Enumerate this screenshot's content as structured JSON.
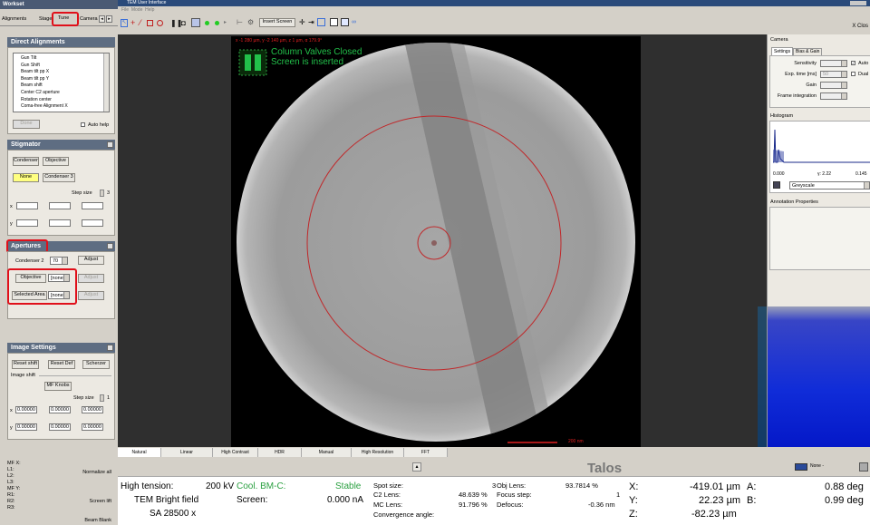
{
  "workset": {
    "title": "Workset",
    "tabs": [
      "Alignments",
      "Stage",
      "Tune",
      "Camera"
    ],
    "direct_alignments": {
      "title": "Direct Alignments",
      "items": [
        "Gun Tilt",
        "Gun Shift",
        "Beam tilt pp X",
        "Beam tilt pp Y",
        "Beam shift",
        "Center C2 aperture",
        "Rotation center",
        "Coma-free Alignment X"
      ],
      "done_label": "Done",
      "auto_help_label": "Auto help"
    },
    "stigmator": {
      "title": "Stigmator",
      "condenser_label": "Condenser",
      "objective_label": "Objective",
      "none_label": "None",
      "condenser3_label": "Condenser 3",
      "step_size_label": "Step size",
      "step_value": "3",
      "x_label": "x",
      "y_label": "y"
    },
    "apertures": {
      "title": "Apertures",
      "condenser2_label": "Condenser 2",
      "condenser2_value": "70",
      "adjust_label": "Adjust",
      "objective_label": "Objective",
      "objective_value": "[none]",
      "selected_area_label": "Selected Area",
      "selected_area_value": "[none]"
    },
    "image_settings": {
      "title": "Image Settings",
      "reset_shift_label": "Reset shift",
      "reset_def_label": "Reset Def",
      "scherzer_label": "Scherzer",
      "image_shift_label": "Image shift",
      "mf_knobs_label": "MF Knobs",
      "step_size_label": "Step size",
      "step_value": "1",
      "x_label": "x",
      "y_label": "y",
      "values": [
        "0.00000",
        "0.00000",
        "0.00000",
        "0.00000",
        "0.00000",
        "0.00000"
      ]
    },
    "mf_labels": [
      "MF X:",
      "L1:",
      "L2:",
      "L3:",
      "MF Y:",
      "R1:",
      "R2:",
      "R3:"
    ],
    "normalize_all": "Normalize all",
    "screen_lift": "Screen lift",
    "beam_blank": "Beam Blank"
  },
  "app": {
    "title": "TEM User Interface",
    "menu": [
      "File",
      "Mode",
      "Help"
    ],
    "insert_screen_label": "Insert Screen",
    "close_label": "X Clos"
  },
  "viewer": {
    "overlay_coords": "x -1 280 µm, y -2 140 µm, z 1 µm, α 179.9°",
    "status_line1": "Column Valves Closed",
    "status_line2": "Screen is inserted",
    "scale_bar": "200 nm",
    "tabs": [
      "Natural",
      "Linear",
      "High Contrast",
      "HDR",
      "Manual",
      "High Resolution",
      "FFT"
    ]
  },
  "camera": {
    "title": "Camera",
    "tabs": [
      "Settings",
      "Bias & Gain"
    ],
    "sensitivity_label": "Sensitivity",
    "auto_label": "Auto",
    "exp_time_label": "Exp. time [ms]",
    "exp_value": "50",
    "dual_label": "Dual",
    "gain_label": "Gain",
    "frame_integration_label": "Frame integration",
    "histogram_title": "Histogram",
    "hist_min": "0.000",
    "hist_gamma": "γ: 2.22",
    "hist_max": "0.145",
    "colormap": "Greyscale",
    "annotation_title": "Annotation Properties"
  },
  "status": {
    "talos": "Talos",
    "none_label": "None -",
    "high_tension_label": "High tension:",
    "high_tension_value": "200 kV",
    "cool_label": "Cool. BM-C:",
    "cool_value": "Stable",
    "mode": "TEM Bright field",
    "screen_label": "Screen:",
    "screen_value": "0.000 nA",
    "mag": "SA 28500 x",
    "spot_size_label": "Spot size:",
    "spot_size_value": "3",
    "c2_lens_label": "C2 Lens:",
    "c2_lens_value": "48.639 %",
    "mc_lens_label": "MC Lens:",
    "mc_lens_value": "91.796 %",
    "convergence_label": "Convergence angle:",
    "obj_lens_label": "Obj Lens:",
    "obj_lens_value": "93.7814 %",
    "focus_step_label": "Focus step:",
    "focus_step_value": "1",
    "defocus_label": "Defocus:",
    "defocus_value": "-0.36 nm",
    "x_label": "X:",
    "x_value": "-419.01 µm",
    "y_label": "Y:",
    "y_value": "22.23 µm",
    "z_label": "Z:",
    "z_value": "-82.23 µm",
    "a_label": "A:",
    "a_value": "0.88 deg",
    "b_label": "B:",
    "b_value": "0.99 deg"
  },
  "colors": {
    "panel_header": "#5e6d82",
    "highlight_red": "#e0101a",
    "overlay_green": "#22c04a",
    "overlay_red": "#e02020"
  }
}
